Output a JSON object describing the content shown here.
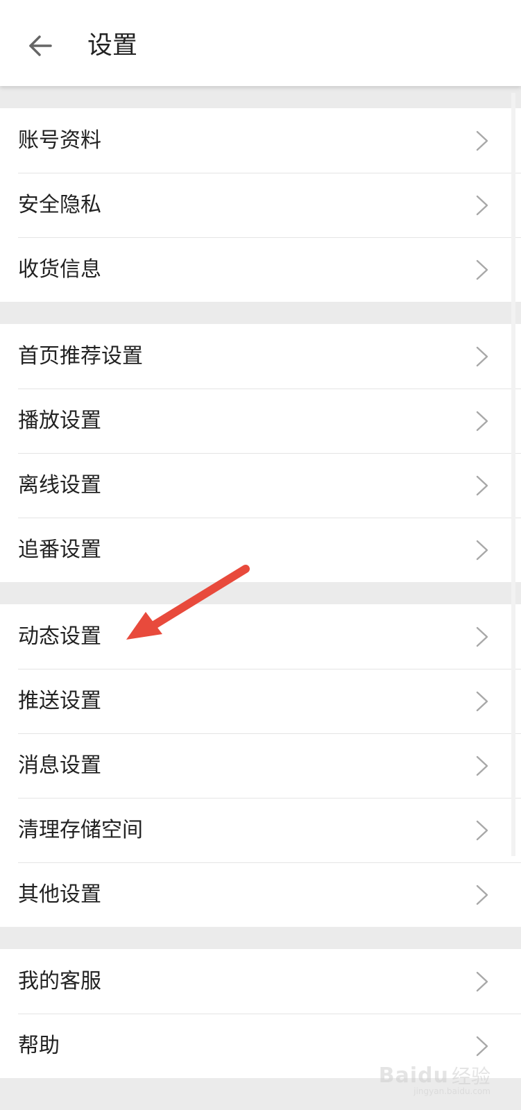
{
  "header": {
    "back_icon": "arrow-left-icon",
    "title": "设置"
  },
  "sections": [
    [
      {
        "label": "账号资料"
      },
      {
        "label": "安全隐私"
      },
      {
        "label": "收货信息"
      }
    ],
    [
      {
        "label": "首页推荐设置"
      },
      {
        "label": "播放设置"
      },
      {
        "label": "离线设置"
      },
      {
        "label": "追番设置"
      }
    ],
    [
      {
        "label": "动态设置"
      },
      {
        "label": "推送设置"
      },
      {
        "label": "消息设置"
      },
      {
        "label": "清理存储空间"
      },
      {
        "label": "其他设置"
      }
    ],
    [
      {
        "label": "我的客服"
      },
      {
        "label": "帮助"
      }
    ]
  ],
  "chevron_icon": "chevron-right-icon",
  "annotation": {
    "type": "red-arrow",
    "target": "动态设置",
    "color": "#e84a3c"
  },
  "watermark": {
    "logo": "Bai",
    "logo_suffix": "du",
    "text": "经验",
    "sub": "jingyan.baidu.com"
  },
  "colors": {
    "background": "#ebebeb",
    "row_bg": "#ffffff",
    "text": "#222222",
    "divider": "#e4e4e4",
    "chevron": "#a8a8a8",
    "arrow": "#e84a3c"
  }
}
